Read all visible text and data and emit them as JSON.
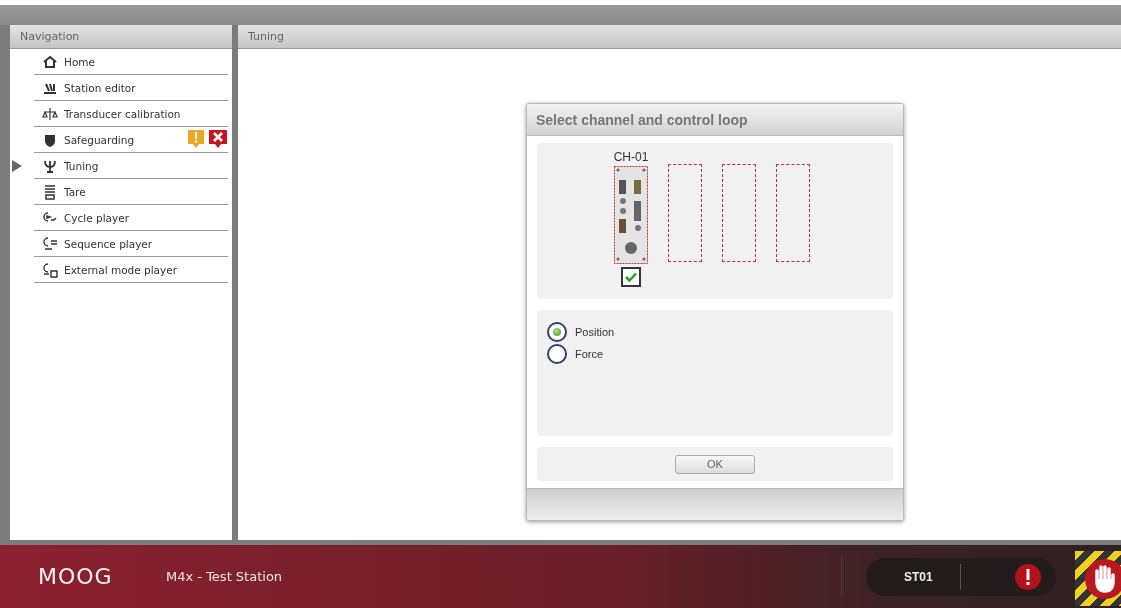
{
  "navigation": {
    "title": "Navigation",
    "items": [
      {
        "label": "Home",
        "selected": false,
        "warning": false,
        "error": false
      },
      {
        "label": "Station editor",
        "selected": false,
        "warning": false,
        "error": false
      },
      {
        "label": "Transducer calibration",
        "selected": false,
        "warning": false,
        "error": false
      },
      {
        "label": "Safeguarding",
        "selected": false,
        "warning": true,
        "error": true
      },
      {
        "label": "Tuning",
        "selected": true,
        "warning": false,
        "error": false
      },
      {
        "label": "Tare",
        "selected": false,
        "warning": false,
        "error": false
      },
      {
        "label": "Cycle player",
        "selected": false,
        "warning": false,
        "error": false
      },
      {
        "label": "Sequence player",
        "selected": false,
        "warning": false,
        "error": false
      },
      {
        "label": "External mode player",
        "selected": false,
        "warning": false,
        "error": false
      }
    ]
  },
  "main": {
    "title": "Tuning"
  },
  "dialog": {
    "title": "Select channel and control loop",
    "slots": [
      {
        "kind": "module",
        "label": "CH-01",
        "checked": true
      },
      {
        "kind": "empty"
      },
      {
        "kind": "empty"
      },
      {
        "kind": "empty"
      }
    ],
    "loops": [
      {
        "label": "Position",
        "selected": true
      },
      {
        "label": "Force",
        "selected": false
      }
    ],
    "ok_button": "OK"
  },
  "footer": {
    "logo": "MOOG",
    "station_title": "M4x - Test Station",
    "station_id": "ST01",
    "alarm": true
  }
}
